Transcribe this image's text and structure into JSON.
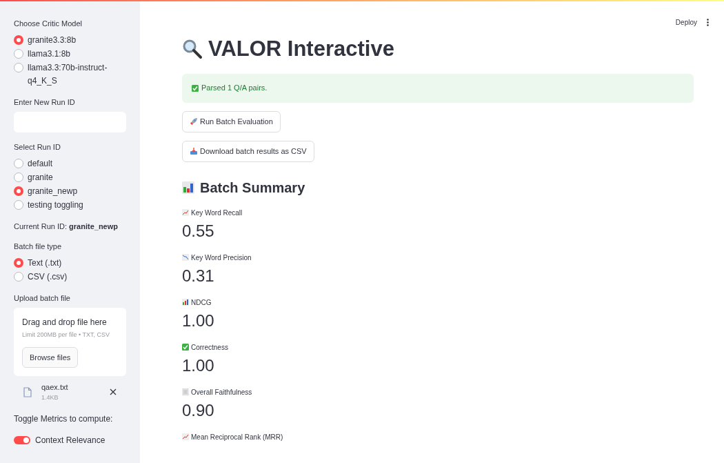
{
  "sidebar": {
    "critic_model": {
      "label": "Choose Critic Model",
      "options": [
        {
          "label": "granite3.3:8b",
          "selected": true
        },
        {
          "label": "llama3.1:8b",
          "selected": false
        },
        {
          "label": "llama3.3:70b-instruct-q4_K_S",
          "selected": false
        }
      ]
    },
    "new_run_id": {
      "label": "Enter New Run ID"
    },
    "run_id": {
      "label": "Select Run ID",
      "options": [
        {
          "label": "default",
          "selected": false
        },
        {
          "label": "granite",
          "selected": false
        },
        {
          "label": "granite_newp",
          "selected": true
        },
        {
          "label": "testing toggling",
          "selected": false
        }
      ]
    },
    "current_run": {
      "label": "Current Run ID: ",
      "value": "granite_newp"
    },
    "file_type": {
      "label": "Batch file type",
      "options": [
        {
          "label": "Text (.txt)",
          "selected": true
        },
        {
          "label": "CSV (.csv)",
          "selected": false
        }
      ]
    },
    "upload": {
      "label": "Upload batch file",
      "drop_text": "Drag and drop file here",
      "limit": "Limit 200MB per file • TXT, CSV",
      "browse": "Browse files",
      "file": {
        "name": "qaex.txt",
        "size": "1.4KB"
      }
    },
    "toggles_label": "Toggle Metrics to compute:",
    "toggles": [
      {
        "label": "Context Relevance",
        "on": true
      }
    ]
  },
  "header": {
    "deploy": "Deploy"
  },
  "title": "VALOR Interactive",
  "success": "Parsed 1 Q/A pairs.",
  "buttons": [
    {
      "kind": "rocket",
      "label": "Run Batch Evaluation"
    },
    {
      "kind": "inbox",
      "label": "Download batch results as CSV"
    }
  ],
  "summary_title": "Batch Summary",
  "metrics": [
    {
      "kind": "up",
      "label": "Key Word Recall",
      "value": "0.55"
    },
    {
      "kind": "down",
      "label": "Key Word Precision",
      "value": "0.31"
    },
    {
      "kind": "bars",
      "label": "NDCG",
      "value": "1.00"
    },
    {
      "kind": "check",
      "label": "Correctness",
      "value": "1.00"
    },
    {
      "kind": "doc",
      "label": "Overall Faithfulness",
      "value": "0.90"
    },
    {
      "kind": "up",
      "label": "Mean Reciprocal Rank (MRR)"
    }
  ]
}
